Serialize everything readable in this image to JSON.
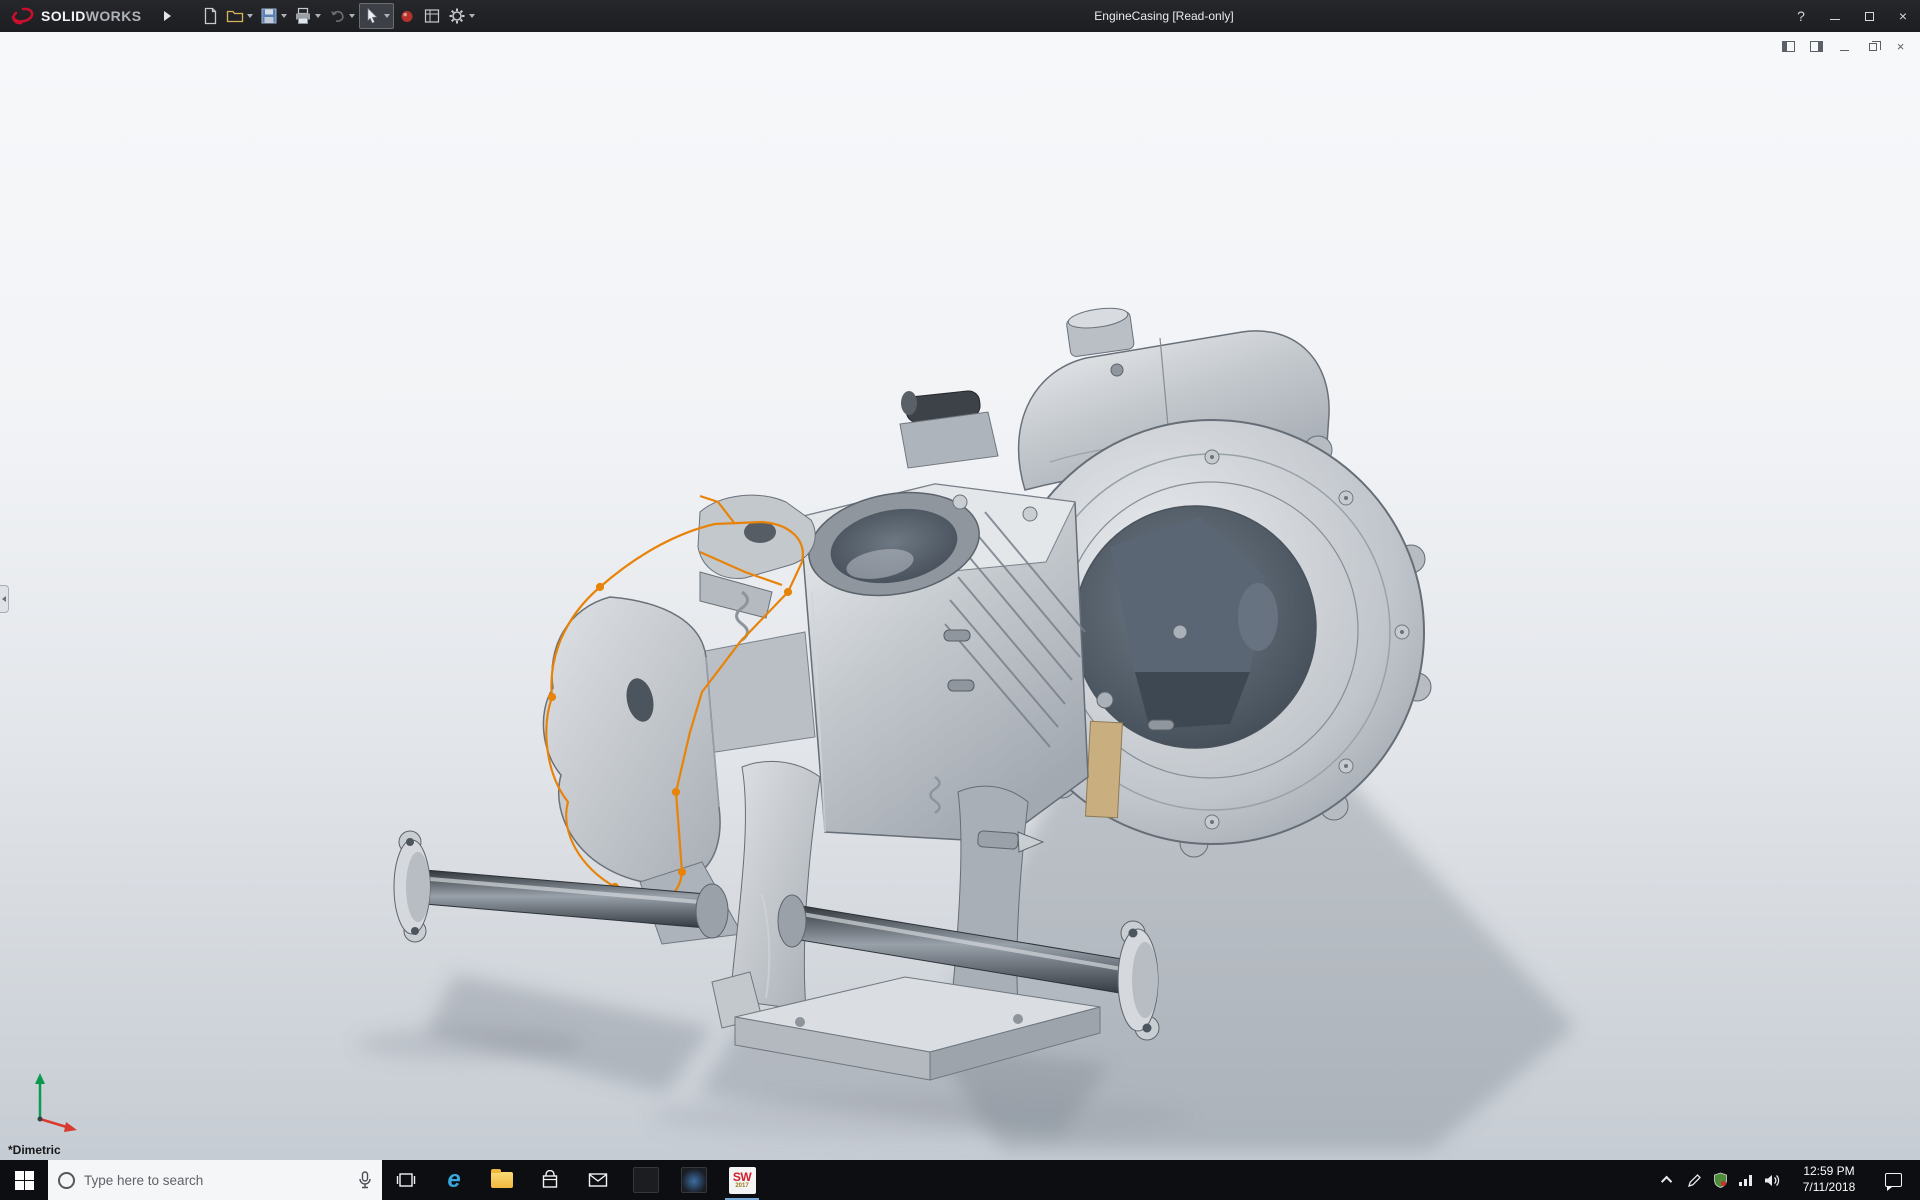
{
  "titlebar": {
    "brand": {
      "solid": "SOLID",
      "works": "WORKS"
    },
    "document_title": "EngineCasing [Read-only]",
    "help_label": "?",
    "close_glyph": "×",
    "toolbar_icons": [
      "new-document",
      "open",
      "save",
      "print",
      "undo",
      "select-arrow",
      "appearance-sphere",
      "view-sheet",
      "options-gear"
    ]
  },
  "document_window": {
    "controls": [
      "pane-left",
      "pane-right",
      "minimize",
      "restore",
      "close"
    ],
    "close_glyph": "×"
  },
  "viewport": {
    "view_orientation_label": "*Dimetric",
    "sketch_color": "#e8830a",
    "model": "engine-casing-assembly"
  },
  "taskbar": {
    "search": {
      "placeholder": "Type here to search"
    },
    "edge_glyph": "e",
    "solidworks": {
      "label": "SW",
      "year": "2017"
    },
    "clock": {
      "time": "12:59 PM",
      "date": "7/11/2018"
    },
    "apps": [
      "start",
      "search",
      "task-view",
      "edge",
      "file-explorer",
      "store",
      "mail",
      "app-dark",
      "app-photos",
      "solidworks-2017"
    ],
    "tray_icons": [
      "hidden-icons-caret",
      "pen",
      "network",
      "volume",
      "action-center",
      "show-desktop"
    ]
  },
  "colors": {
    "titlebar_bg": "#1d1e22",
    "taskbar_bg": "#0d0e11",
    "sketch_orange": "#e8830a",
    "brand_red": "#c8102e"
  }
}
